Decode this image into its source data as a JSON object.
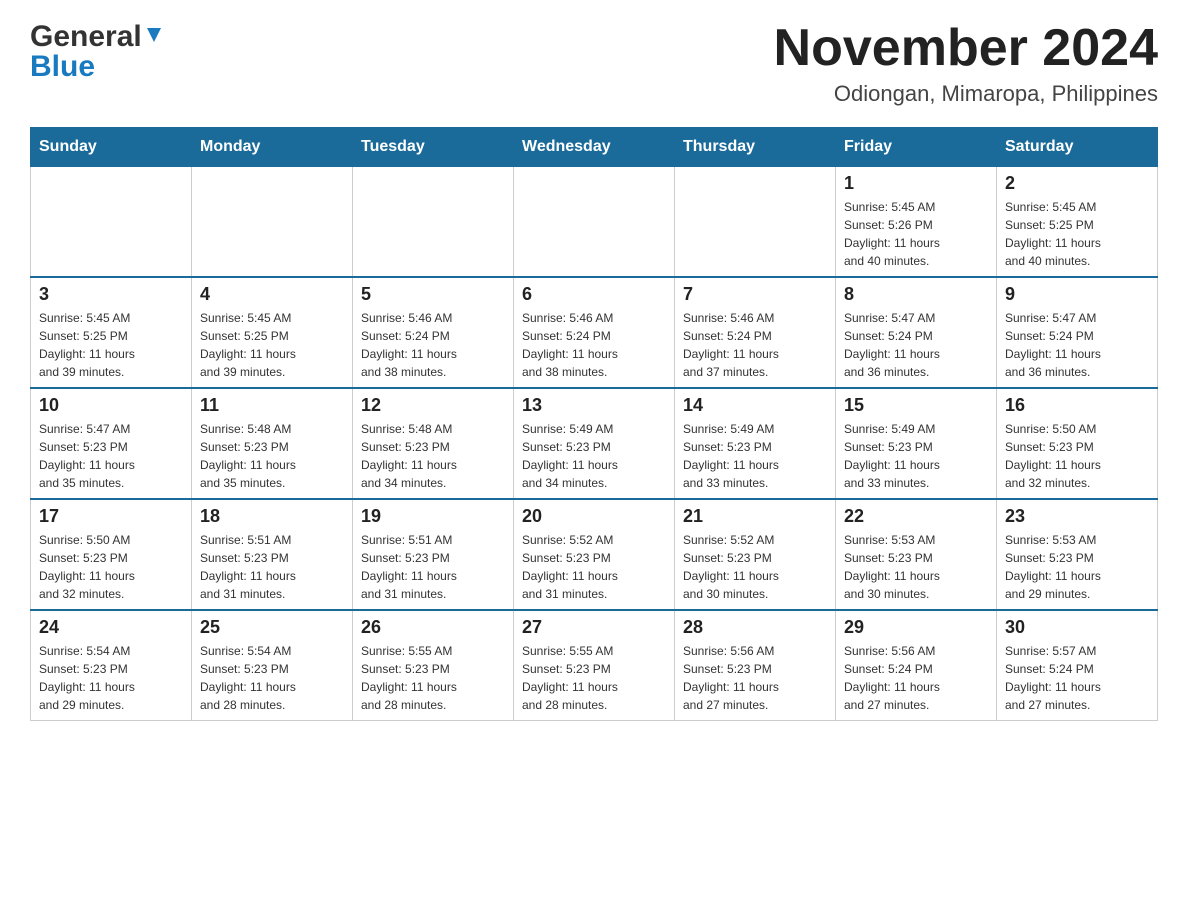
{
  "header": {
    "logo": {
      "general": "General",
      "blue": "Blue"
    },
    "month_title": "November 2024",
    "location": "Odiongan, Mimaropa, Philippines"
  },
  "calendar": {
    "days_of_week": [
      "Sunday",
      "Monday",
      "Tuesday",
      "Wednesday",
      "Thursday",
      "Friday",
      "Saturday"
    ],
    "weeks": [
      [
        {
          "day": "",
          "info": ""
        },
        {
          "day": "",
          "info": ""
        },
        {
          "day": "",
          "info": ""
        },
        {
          "day": "",
          "info": ""
        },
        {
          "day": "",
          "info": ""
        },
        {
          "day": "1",
          "info": "Sunrise: 5:45 AM\nSunset: 5:26 PM\nDaylight: 11 hours\nand 40 minutes."
        },
        {
          "day": "2",
          "info": "Sunrise: 5:45 AM\nSunset: 5:25 PM\nDaylight: 11 hours\nand 40 minutes."
        }
      ],
      [
        {
          "day": "3",
          "info": "Sunrise: 5:45 AM\nSunset: 5:25 PM\nDaylight: 11 hours\nand 39 minutes."
        },
        {
          "day": "4",
          "info": "Sunrise: 5:45 AM\nSunset: 5:25 PM\nDaylight: 11 hours\nand 39 minutes."
        },
        {
          "day": "5",
          "info": "Sunrise: 5:46 AM\nSunset: 5:24 PM\nDaylight: 11 hours\nand 38 minutes."
        },
        {
          "day": "6",
          "info": "Sunrise: 5:46 AM\nSunset: 5:24 PM\nDaylight: 11 hours\nand 38 minutes."
        },
        {
          "day": "7",
          "info": "Sunrise: 5:46 AM\nSunset: 5:24 PM\nDaylight: 11 hours\nand 37 minutes."
        },
        {
          "day": "8",
          "info": "Sunrise: 5:47 AM\nSunset: 5:24 PM\nDaylight: 11 hours\nand 36 minutes."
        },
        {
          "day": "9",
          "info": "Sunrise: 5:47 AM\nSunset: 5:24 PM\nDaylight: 11 hours\nand 36 minutes."
        }
      ],
      [
        {
          "day": "10",
          "info": "Sunrise: 5:47 AM\nSunset: 5:23 PM\nDaylight: 11 hours\nand 35 minutes."
        },
        {
          "day": "11",
          "info": "Sunrise: 5:48 AM\nSunset: 5:23 PM\nDaylight: 11 hours\nand 35 minutes."
        },
        {
          "day": "12",
          "info": "Sunrise: 5:48 AM\nSunset: 5:23 PM\nDaylight: 11 hours\nand 34 minutes."
        },
        {
          "day": "13",
          "info": "Sunrise: 5:49 AM\nSunset: 5:23 PM\nDaylight: 11 hours\nand 34 minutes."
        },
        {
          "day": "14",
          "info": "Sunrise: 5:49 AM\nSunset: 5:23 PM\nDaylight: 11 hours\nand 33 minutes."
        },
        {
          "day": "15",
          "info": "Sunrise: 5:49 AM\nSunset: 5:23 PM\nDaylight: 11 hours\nand 33 minutes."
        },
        {
          "day": "16",
          "info": "Sunrise: 5:50 AM\nSunset: 5:23 PM\nDaylight: 11 hours\nand 32 minutes."
        }
      ],
      [
        {
          "day": "17",
          "info": "Sunrise: 5:50 AM\nSunset: 5:23 PM\nDaylight: 11 hours\nand 32 minutes."
        },
        {
          "day": "18",
          "info": "Sunrise: 5:51 AM\nSunset: 5:23 PM\nDaylight: 11 hours\nand 31 minutes."
        },
        {
          "day": "19",
          "info": "Sunrise: 5:51 AM\nSunset: 5:23 PM\nDaylight: 11 hours\nand 31 minutes."
        },
        {
          "day": "20",
          "info": "Sunrise: 5:52 AM\nSunset: 5:23 PM\nDaylight: 11 hours\nand 31 minutes."
        },
        {
          "day": "21",
          "info": "Sunrise: 5:52 AM\nSunset: 5:23 PM\nDaylight: 11 hours\nand 30 minutes."
        },
        {
          "day": "22",
          "info": "Sunrise: 5:53 AM\nSunset: 5:23 PM\nDaylight: 11 hours\nand 30 minutes."
        },
        {
          "day": "23",
          "info": "Sunrise: 5:53 AM\nSunset: 5:23 PM\nDaylight: 11 hours\nand 29 minutes."
        }
      ],
      [
        {
          "day": "24",
          "info": "Sunrise: 5:54 AM\nSunset: 5:23 PM\nDaylight: 11 hours\nand 29 minutes."
        },
        {
          "day": "25",
          "info": "Sunrise: 5:54 AM\nSunset: 5:23 PM\nDaylight: 11 hours\nand 28 minutes."
        },
        {
          "day": "26",
          "info": "Sunrise: 5:55 AM\nSunset: 5:23 PM\nDaylight: 11 hours\nand 28 minutes."
        },
        {
          "day": "27",
          "info": "Sunrise: 5:55 AM\nSunset: 5:23 PM\nDaylight: 11 hours\nand 28 minutes."
        },
        {
          "day": "28",
          "info": "Sunrise: 5:56 AM\nSunset: 5:23 PM\nDaylight: 11 hours\nand 27 minutes."
        },
        {
          "day": "29",
          "info": "Sunrise: 5:56 AM\nSunset: 5:24 PM\nDaylight: 11 hours\nand 27 minutes."
        },
        {
          "day": "30",
          "info": "Sunrise: 5:57 AM\nSunset: 5:24 PM\nDaylight: 11 hours\nand 27 minutes."
        }
      ]
    ]
  }
}
